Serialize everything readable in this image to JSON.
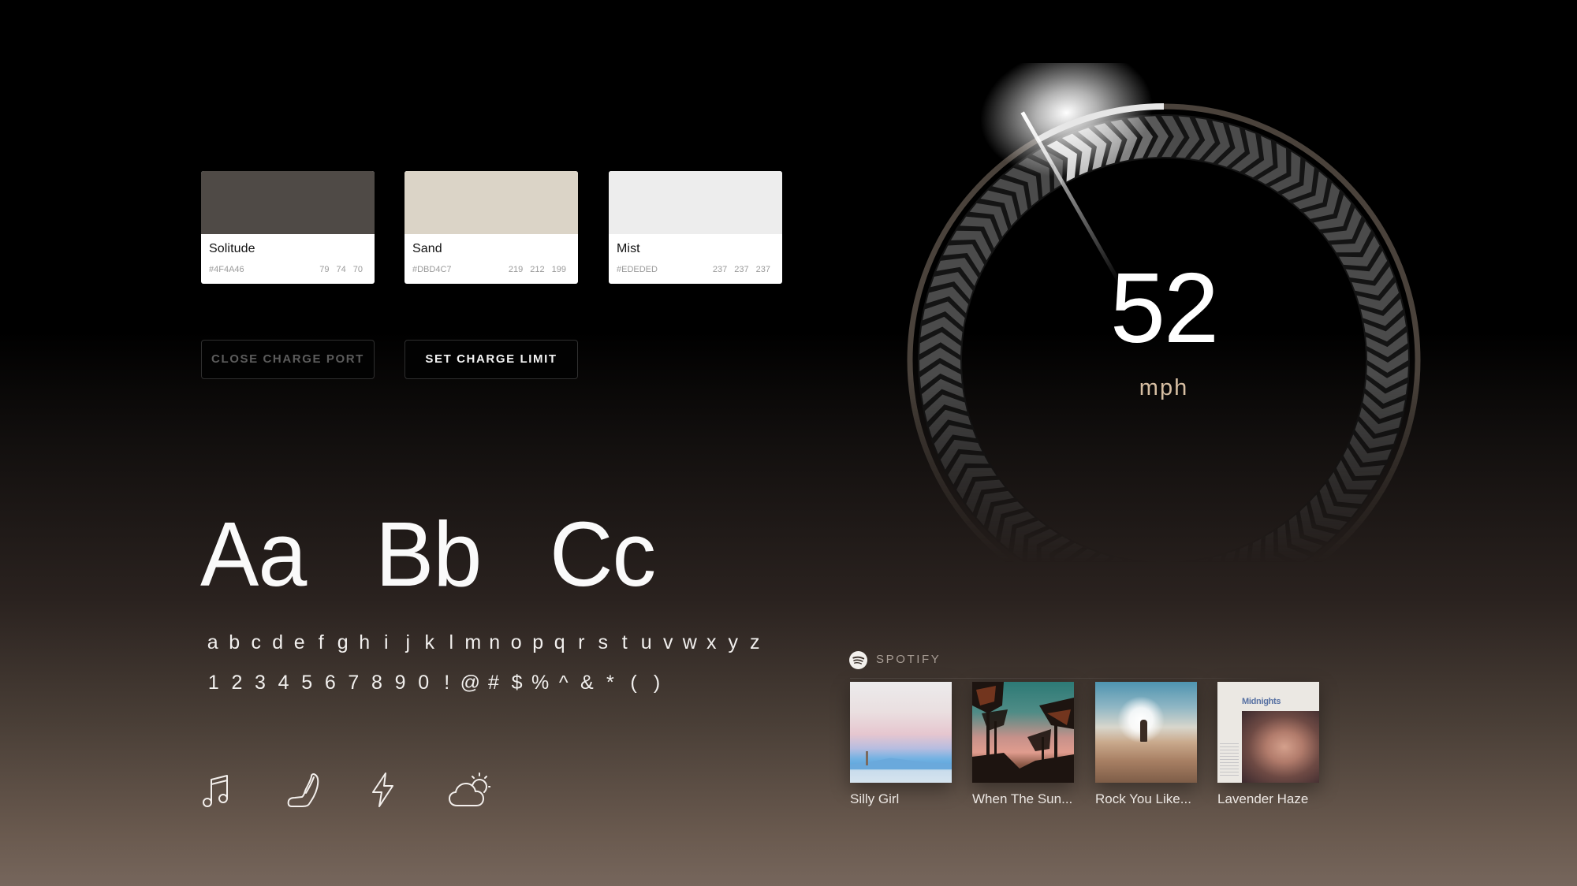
{
  "swatches": [
    {
      "name": "Solitude",
      "hex": "#4F4A46",
      "rgb": [
        "79",
        "74",
        "70"
      ],
      "color": "#4F4A46"
    },
    {
      "name": "Sand",
      "hex": "#DBD4C7",
      "rgb": [
        "219",
        "212",
        "199"
      ],
      "color": "#DBD4C7"
    },
    {
      "name": "Mist",
      "hex": "#EDEDED",
      "rgb": [
        "237",
        "237",
        "237"
      ],
      "color": "#EDEDED"
    }
  ],
  "buttons": {
    "close_charge_port": "CLOSE CHARGE PORT",
    "set_charge_limit": "SET CHARGE LIMIT"
  },
  "typography": {
    "specimens": [
      "Aa",
      "Bb",
      "Cc"
    ],
    "lowercase": [
      "a",
      "b",
      "c",
      "d",
      "e",
      "f",
      "g",
      "h",
      "i",
      "j",
      "k",
      "l",
      "m",
      "n",
      "o",
      "p",
      "q",
      "r",
      "s",
      "t",
      "u",
      "v",
      "w",
      "x",
      "y",
      "z"
    ],
    "numerals_symbols": [
      "1",
      "2",
      "3",
      "4",
      "5",
      "6",
      "7",
      "8",
      "9",
      "0",
      "!",
      "@",
      "#",
      "$",
      "%",
      "^",
      "&",
      "*",
      "(",
      ")"
    ]
  },
  "icons": [
    "music-icon",
    "seat-icon",
    "bolt-icon",
    "partly-cloudy-icon"
  ],
  "speedometer": {
    "speed": "52",
    "unit": "mph",
    "needle_fraction_of_sweep": 0.39,
    "accent_color": "#D6BEA2",
    "ring_color": "#4F4A46"
  },
  "spotify": {
    "label": "SPOTIFY",
    "albums": [
      {
        "title": "Silly Girl"
      },
      {
        "title": "When The Sun..."
      },
      {
        "title": "Rock You Like..."
      },
      {
        "title": "Lavender Haze",
        "cover_text": "Midnights"
      }
    ]
  }
}
